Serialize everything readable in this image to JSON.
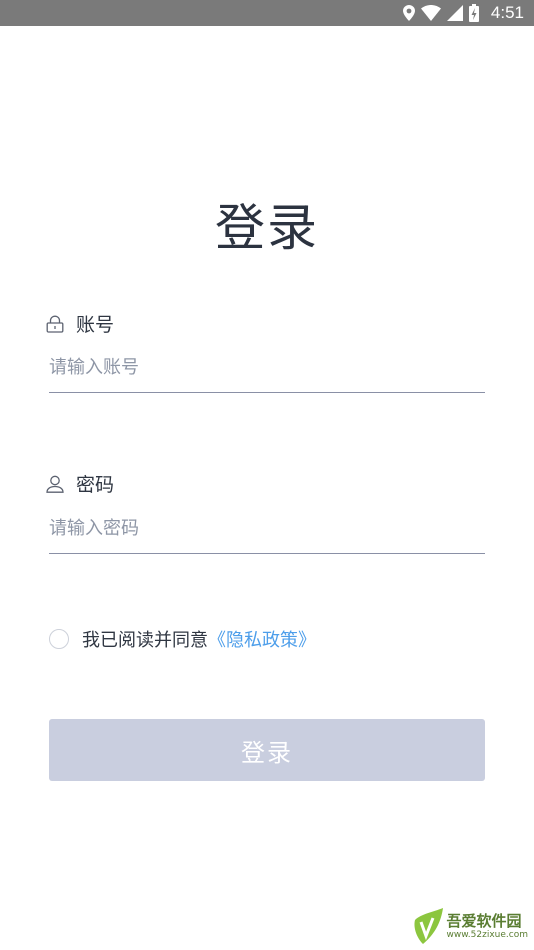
{
  "status_bar": {
    "time": "4:51",
    "icons": [
      "location-icon",
      "wifi-icon",
      "signal-icon",
      "battery-icon"
    ]
  },
  "page": {
    "title": "登录"
  },
  "account": {
    "label": "账号",
    "placeholder": "请输入账号",
    "value": "",
    "icon": "lock-icon"
  },
  "password": {
    "label": "密码",
    "placeholder": "请输入密码",
    "value": "",
    "icon": "user-icon"
  },
  "agreement": {
    "checked": false,
    "text": "我已阅读并同意",
    "link_text": "《隐私政策》"
  },
  "login_button": {
    "label": "登录"
  },
  "watermark": {
    "name": "吾爱软件园",
    "url": "www.52zixue.com"
  },
  "colors": {
    "title": "#2c3340",
    "link": "#4d9eea",
    "button_disabled": "#c9cedf",
    "underline": "#8a90a6",
    "status_bar": "#7a7a7a"
  }
}
